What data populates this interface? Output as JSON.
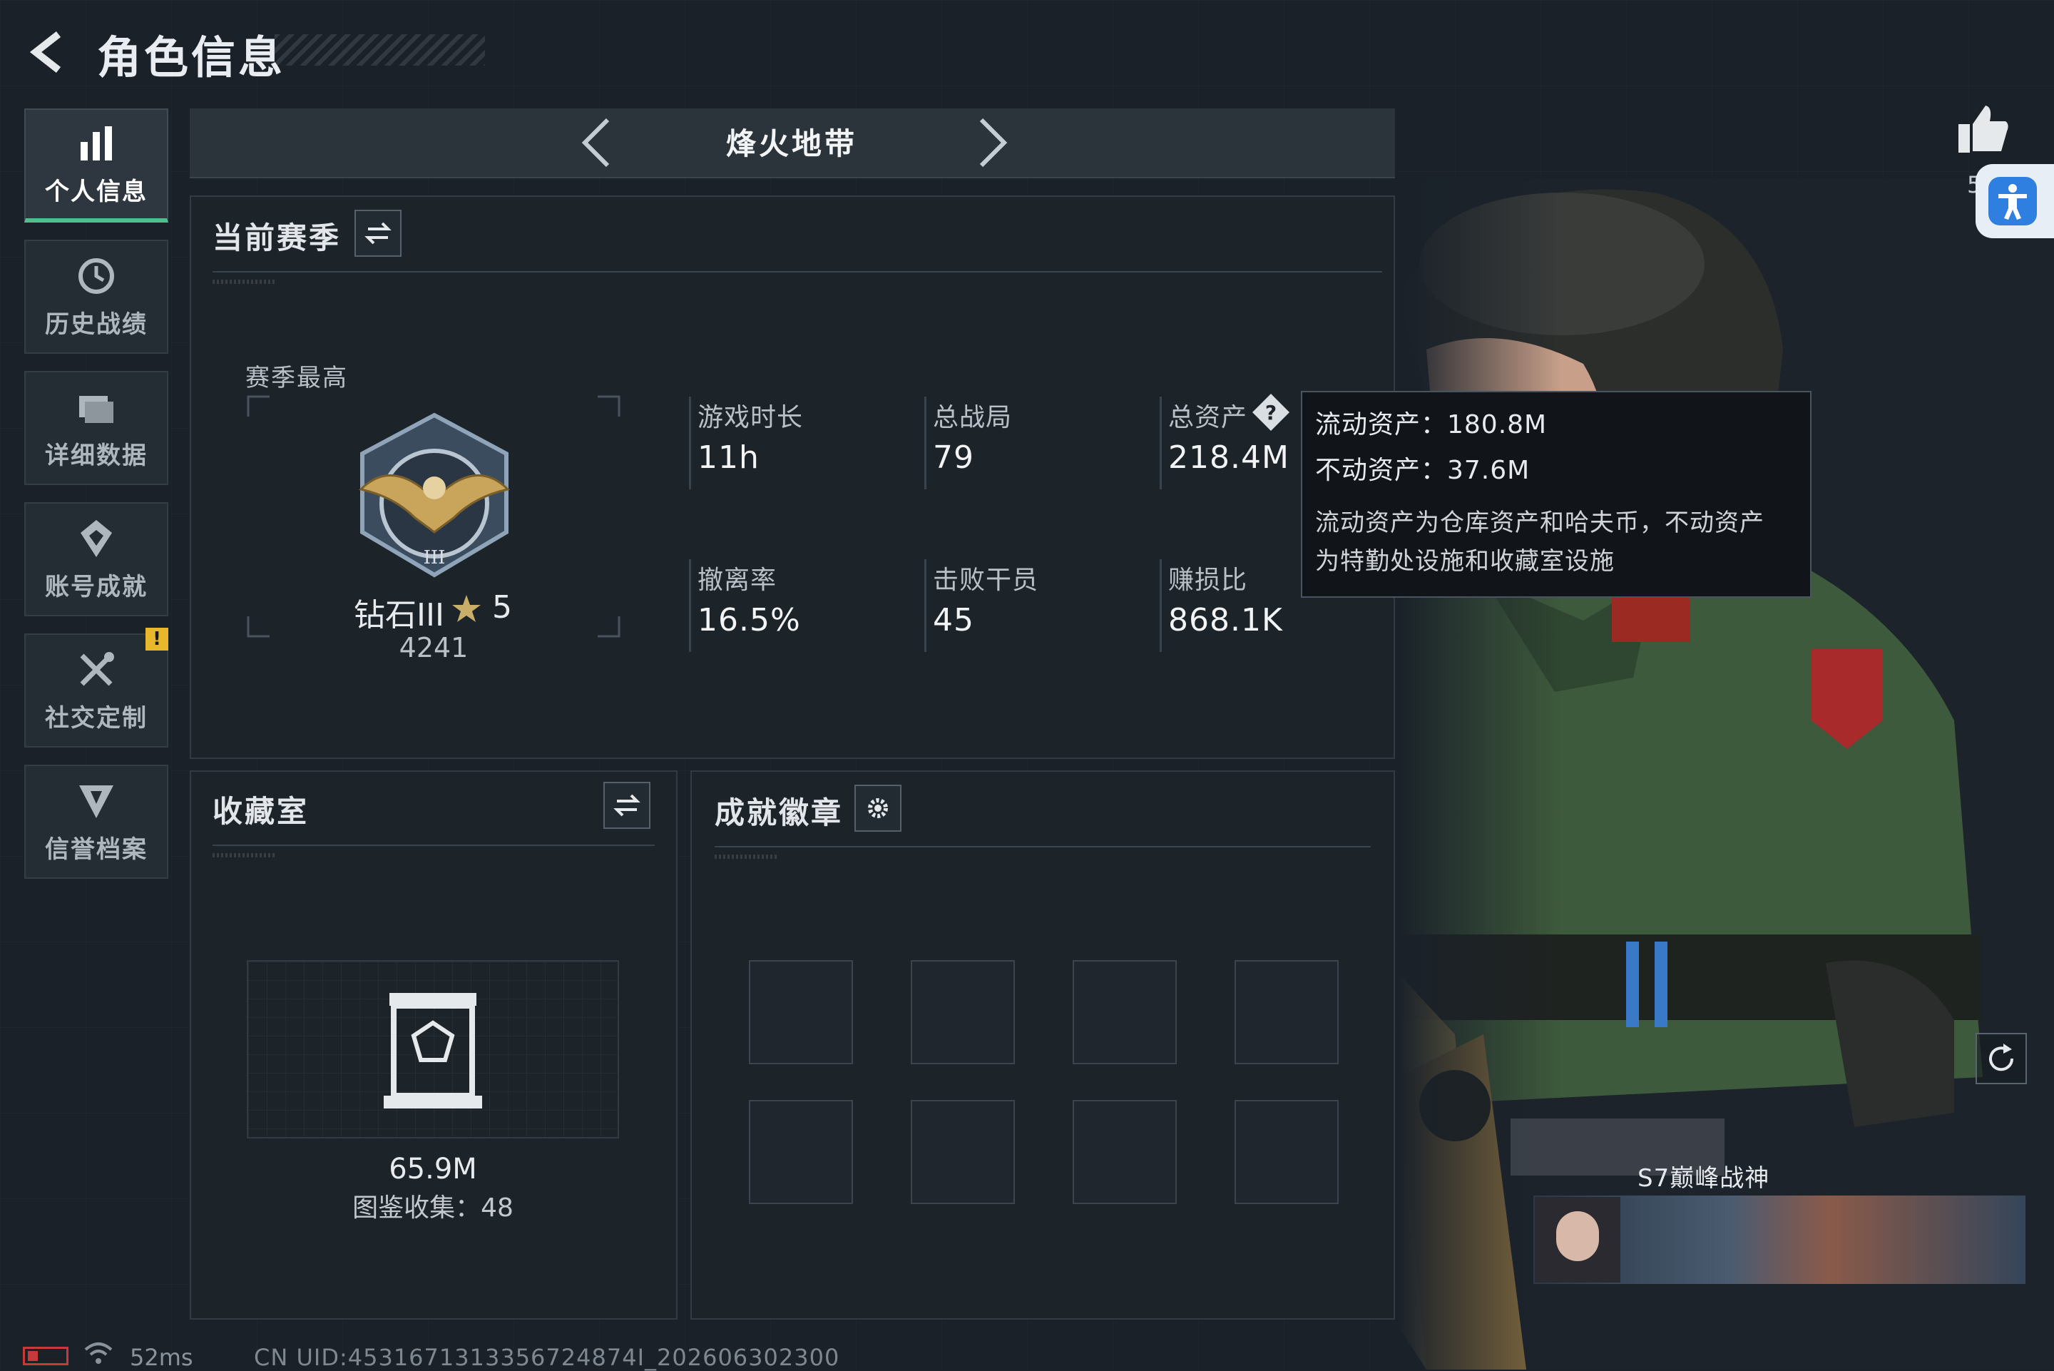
{
  "header": {
    "title": "角色信息"
  },
  "sidebar": {
    "items": [
      {
        "label": "个人信息",
        "icon": "bar-chart-icon",
        "active": true
      },
      {
        "label": "历史战绩",
        "icon": "clock-icon",
        "active": false
      },
      {
        "label": "详细数据",
        "icon": "folder-icon",
        "active": false
      },
      {
        "label": "账号成就",
        "icon": "achievement-icon",
        "active": false
      },
      {
        "label": "社交定制",
        "icon": "tools-icon",
        "active": false,
        "alert": "!"
      },
      {
        "label": "信誉档案",
        "icon": "shield-icon",
        "active": false
      }
    ]
  },
  "mode": {
    "title": "烽火地带"
  },
  "season": {
    "title": "当前赛季",
    "best_label": "赛季最高",
    "rank_name": "钻石III",
    "rank_stars": "5",
    "rank_points": "4241",
    "stats": [
      {
        "label": "游戏时长",
        "value": "11h"
      },
      {
        "label": "总战局",
        "value": "79"
      },
      {
        "label": "总资产",
        "value": "218.4M"
      },
      {
        "label": "撤离率",
        "value": "16.5%"
      },
      {
        "label": "击败干员",
        "value": "45"
      },
      {
        "label": "赚损比",
        "value": "868.1K"
      }
    ]
  },
  "tooltip": {
    "liquid": "流动资产：180.8M",
    "fixed": "不动资产：37.6M",
    "desc_line1": "流动资产为仓库资产和哈夫币，不动资产",
    "desc_line2": "为特勤处设施和收藏室设施"
  },
  "collection": {
    "title": "收藏室",
    "value": "65.9M",
    "catalog": "图鉴收集：48"
  },
  "badges": {
    "title": "成就徽章"
  },
  "character": {
    "nameplate": "S7巅峰战神",
    "likes": "5"
  },
  "footer": {
    "ping": "52ms",
    "uid": "CN UID:4531671313356724874I_202606302300"
  },
  "colors": {
    "accent_green": "#4fc08d",
    "alert_yellow": "#e8b82c",
    "battery_red": "#c83a3a",
    "access_blue": "#2f7fe0"
  }
}
